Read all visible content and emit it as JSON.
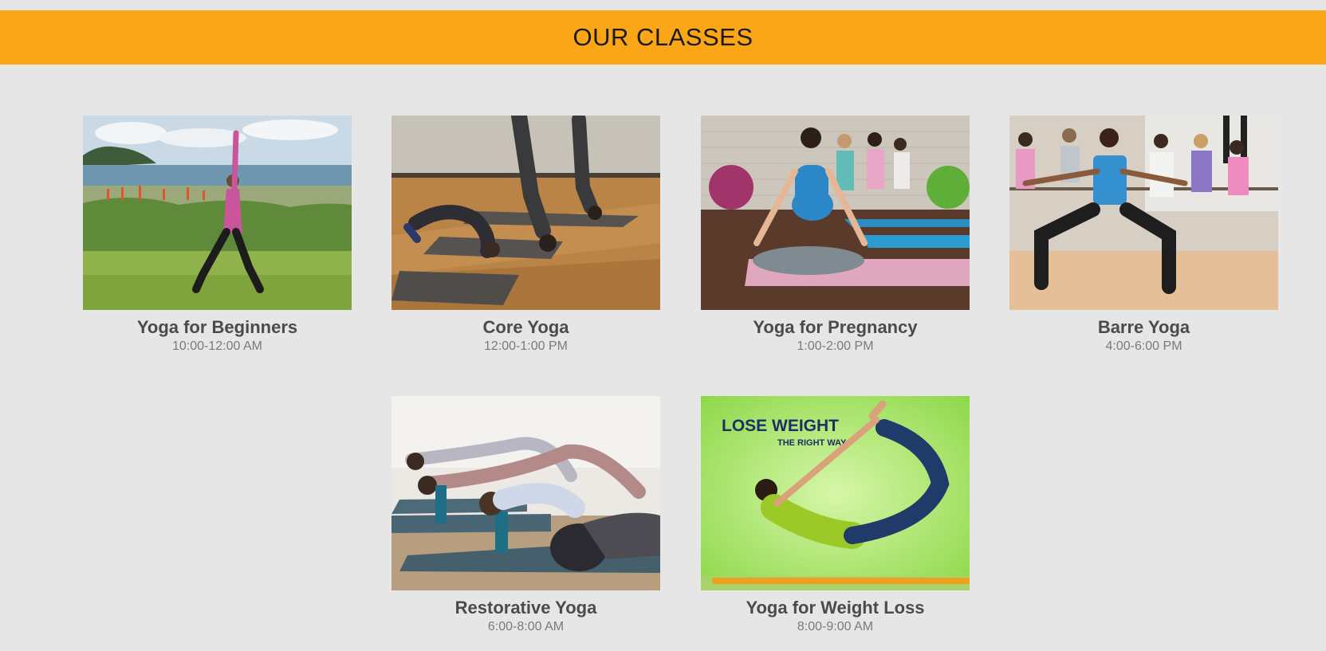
{
  "header": {
    "title": "OUR CLASSES",
    "background_color": "#fba617"
  },
  "classes": [
    {
      "name": "Yoga for Beginners",
      "time": "10:00-12:00 AM",
      "image": "woman-warrior-pose-by-sea-photo"
    },
    {
      "name": "Core Yoga",
      "time": "12:00-1:00 PM",
      "image": "headstand-crow-pose-studio-photo"
    },
    {
      "name": "Yoga for Pregnancy",
      "time": "1:00-2:00 PM",
      "image": "pregnant-woman-meditating-photo"
    },
    {
      "name": "Barre Yoga",
      "time": "4:00-6:00 PM",
      "image": "barre-class-plie-photo"
    },
    {
      "name": "Restorative Yoga",
      "time": "6:00-8:00 AM",
      "image": "supported-backbend-bolster-photo"
    },
    {
      "name": "Yoga for Weight Loss",
      "time": "8:00-9:00 AM",
      "image": "bow-pose-green-background-photo",
      "image_text": {
        "headline": "LOSE WEIGHT",
        "tagline": "THE RIGHT WAY"
      }
    }
  ]
}
